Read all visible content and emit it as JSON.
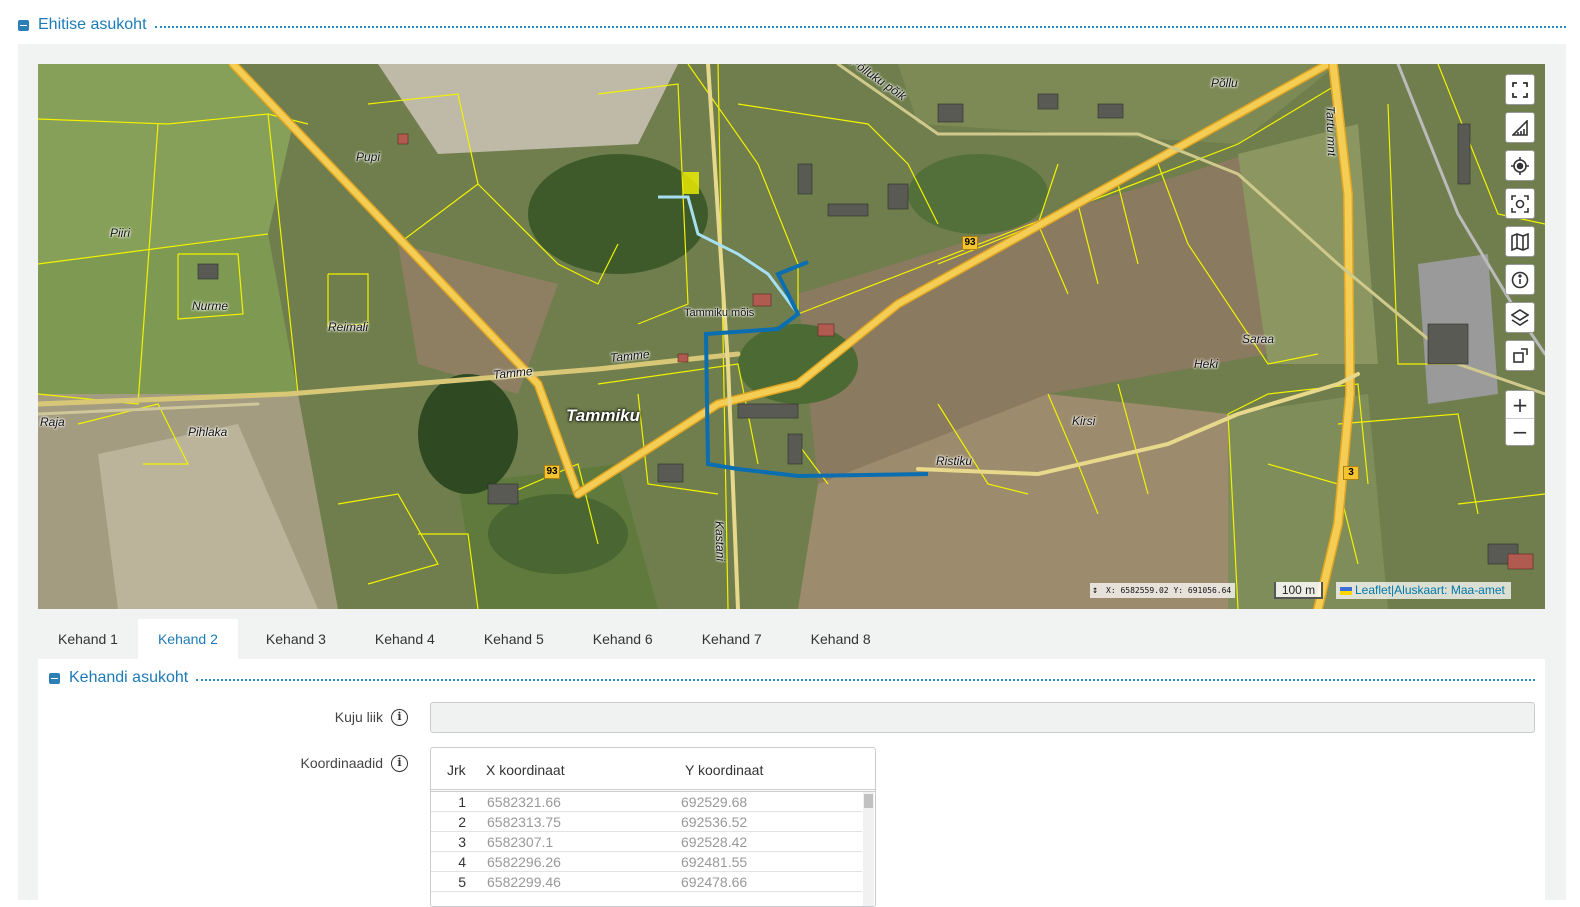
{
  "section": {
    "title": "Ehitise asukoht"
  },
  "map": {
    "labels": {
      "pupi": "Pupi",
      "piiri": "Piiri",
      "nurme": "Nurme",
      "reimali": "Reimali",
      "raja": "Raja",
      "pihlaka": "Pihlaka",
      "tammiku": "Tammiku",
      "tammiku_mois": "Tammiku mõis",
      "tamme1": "Tamme",
      "tamme2": "Tamme",
      "polluku": "Põlluku põik",
      "pollu": "Põllu",
      "saraa": "Saraa",
      "heki": "Heki",
      "kirsi": "Kirsi",
      "ristiku": "Ristiku",
      "tartu_mnt": "Tartu mnt",
      "kastani": "Kastani",
      "roadnum_a": "93",
      "roadnum_b": "93",
      "roadnum_c": "3"
    },
    "coordinates": {
      "x": "X: 6582559.02",
      "y": "Y: 691056.64"
    },
    "scale": "100 m",
    "attribution": {
      "leaflet": "Leaflet",
      "separator": "|",
      "basemap": "Aluskaart: Maa-amet"
    },
    "controls": {
      "fullscreen": "fullscreen-icon",
      "measure": "measure-icon",
      "locate": "locate-icon",
      "screenshot": "screenshot-icon",
      "basemap": "map-icon",
      "info": "info-icon",
      "layers": "layers-icon",
      "draw": "draw-icon",
      "zoom_in": "+",
      "zoom_out": "−"
    },
    "colors": {
      "parcel": "#f2f200",
      "route_dark": "#0a6eb0",
      "route_light": "#9fd9ee",
      "road": "#f5c542"
    }
  },
  "tabs": [
    {
      "label": "Kehand 1",
      "active": false
    },
    {
      "label": "Kehand 2",
      "active": true
    },
    {
      "label": "Kehand 3",
      "active": false
    },
    {
      "label": "Kehand 4",
      "active": false
    },
    {
      "label": "Kehand 5",
      "active": false
    },
    {
      "label": "Kehand 6",
      "active": false
    },
    {
      "label": "Kehand 7",
      "active": false
    },
    {
      "label": "Kehand 8",
      "active": false
    }
  ],
  "kehand": {
    "title": "Kehandi asukoht",
    "shape_label": "Kuju liik",
    "shape_value": "",
    "coords_label": "Koordinaadid",
    "table": {
      "headers": {
        "jrk": "Jrk",
        "x": "X koordinaat",
        "y": "Y koordinaat"
      },
      "rows": [
        {
          "jrk": "1",
          "x": "6582321.66",
          "y": "692529.68"
        },
        {
          "jrk": "2",
          "x": "6582313.75",
          "y": "692536.52"
        },
        {
          "jrk": "3",
          "x": "6582307.1",
          "y": "692528.42"
        },
        {
          "jrk": "4",
          "x": "6582296.26",
          "y": "692481.55"
        },
        {
          "jrk": "5",
          "x": "6582299.46",
          "y": "692478.66"
        }
      ]
    }
  }
}
